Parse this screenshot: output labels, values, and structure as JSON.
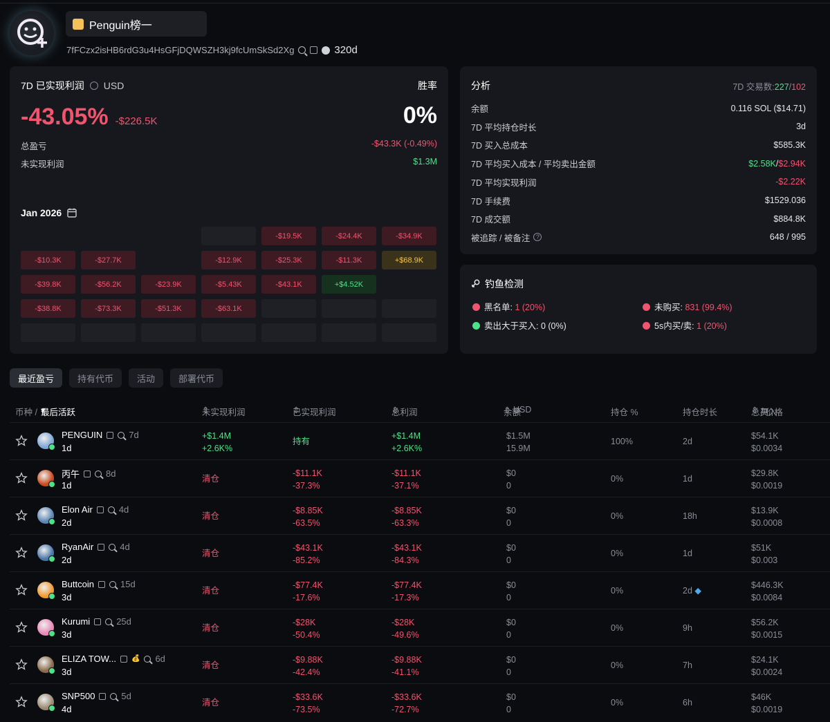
{
  "profile": {
    "name": "Penguin榜一",
    "address": "7fFCzx2isHB6rdG3u4HsGFjDQWSZH3kj9fcUmSkSd2Xg",
    "balance_days": "320d"
  },
  "pnl": {
    "title": "7D 已实现利润",
    "currency": "USD",
    "winrate_label": "胜率",
    "pct": "-43.05%",
    "amount": "-$226.5K",
    "winrate": "0%",
    "total_label": "总盈亏",
    "total_value": "-$43.3K (-0.49%)",
    "unrealized_label": "未实现利润",
    "unrealized_value": "$1.3M",
    "month": "Jan 2026",
    "calendar": [
      [
        "",
        "",
        "",
        "",
        "-$19.5K",
        "-$24.4K",
        "-$34.9K"
      ],
      [
        "-$10.3K",
        "-$27.7K",
        "",
        "-$12.9K",
        "-$25.3K",
        "-$11.3K",
        "+$68.9K"
      ],
      [
        "-$39.8K",
        "-$56.2K",
        "-$23.9K",
        "-$5.43K",
        "-$43.1K",
        "+$4.52K",
        ""
      ],
      [
        "-$38.8K",
        "-$73.3K",
        "-$51.3K",
        "-$63.1K",
        "",
        "",
        ""
      ],
      [
        "",
        "",
        "",
        "",
        "",
        "",
        ""
      ]
    ]
  },
  "analysis": {
    "title": "分析",
    "trades_label": "7D 交易数:",
    "trades_buy": "227",
    "trades_sep": "/",
    "trades_sell": "102",
    "rows": [
      {
        "label": "余额",
        "value": "0.116 SOL ($14.71)"
      },
      {
        "label": "7D 平均持仓时长",
        "value": "3d"
      },
      {
        "label": "7D 买入总成本",
        "value": "$585.3K"
      },
      {
        "label": "7D 平均买入成本 / 平均卖出金额",
        "value": "$2.58K"
      },
      {
        "label": "7D 平均实现利润",
        "value": "-$2.22K"
      },
      {
        "label": "7D 手续费",
        "value": "$1529.036"
      },
      {
        "label": "7D 成交额",
        "value": "$884.8K"
      },
      {
        "label": "被追踪 / 被备注",
        "value": "648 / 995"
      }
    ],
    "avg_sell": "$2.94K",
    "avg_sep": "/"
  },
  "phishing": {
    "title": "钓鱼检测",
    "blacklist_label": "黑名单:",
    "blacklist_value": "1 (20%)",
    "nobuy_label": "未购买:",
    "nobuy_value": "831 (99.4%)",
    "sellgt_label": "卖出大于买入:",
    "sellgt_value": "0 (0%)",
    "fast_label": "5s内买/卖:",
    "fast_value": "1 (20%)"
  },
  "tabs": [
    "最近盈亏",
    "持有代币",
    "活动",
    "部署代币"
  ],
  "columns": {
    "coin": "币种 /",
    "last_active": "最后活跃",
    "unrealized": "未实现利润",
    "realized": "已实现利润",
    "total": "总利润",
    "balance": "余额",
    "usd": "USD",
    "position": "持仓 %",
    "duration": "持仓时长",
    "total_buy": "总买入",
    "price": "/ 价格"
  },
  "rows": [
    {
      "name": "PENGUIN",
      "age": "7d",
      "active": "1d",
      "unreal1": "+$1.4M",
      "unreal2": "+2.6K%",
      "realized1": "持有",
      "realized2": "",
      "total1": "+$1.4M",
      "total2": "+2.6K%",
      "bal1": "$1.5M",
      "bal2": "15.9M",
      "pos": "100%",
      "dur": "2d",
      "buy": "$54.1K",
      "price": "$0.0034",
      "color": "#7fa7d6"
    },
    {
      "name": "丙午",
      "age": "8d",
      "active": "1d",
      "unreal1": "清仓",
      "unreal2": "",
      "realized1": "-$11.1K",
      "realized2": "-37.3%",
      "total1": "-$11.1K",
      "total2": "-37.1%",
      "bal1": "$0",
      "bal2": "0",
      "pos": "0%",
      "dur": "1d",
      "buy": "$29.8K",
      "price": "$0.0019",
      "color": "#c84a1e"
    },
    {
      "name": "Elon Air",
      "age": "4d",
      "active": "2d",
      "unreal1": "清仓",
      "unreal2": "",
      "realized1": "-$8.85K",
      "realized2": "-63.5%",
      "total1": "-$8.85K",
      "total2": "-63.3%",
      "bal1": "$0",
      "bal2": "0",
      "pos": "0%",
      "dur": "18h",
      "buy": "$13.9K",
      "price": "$0.0008",
      "color": "#5a86b5"
    },
    {
      "name": "RyanAir",
      "age": "4d",
      "active": "2d",
      "unreal1": "清仓",
      "unreal2": "",
      "realized1": "-$43.1K",
      "realized2": "-85.2%",
      "total1": "-$43.1K",
      "total2": "-84.3%",
      "bal1": "$0",
      "bal2": "0",
      "pos": "0%",
      "dur": "1d",
      "buy": "$51K",
      "price": "$0.003",
      "color": "#4a76a8"
    },
    {
      "name": "Buttcoin",
      "age": "15d",
      "active": "3d",
      "unreal1": "清仓",
      "unreal2": "",
      "realized1": "-$77.4K",
      "realized2": "-17.6%",
      "total1": "-$77.4K",
      "total2": "-17.3%",
      "bal1": "$0",
      "bal2": "0",
      "pos": "0%",
      "dur": "2d",
      "buy": "$446.3K",
      "price": "$0.0084",
      "color": "#f29a2e"
    },
    {
      "name": "Kurumi",
      "age": "25d",
      "active": "3d",
      "unreal1": "清仓",
      "unreal2": "",
      "realized1": "-$28K",
      "realized2": "-50.4%",
      "total1": "-$28K",
      "total2": "-49.6%",
      "bal1": "$0",
      "bal2": "0",
      "pos": "0%",
      "dur": "9h",
      "buy": "$56.2K",
      "price": "$0.0015",
      "color": "#e889b6"
    },
    {
      "name": "ELIZA TOW...",
      "age": "6d",
      "active": "3d",
      "unreal1": "清仓",
      "unreal2": "",
      "realized1": "-$9.88K",
      "realized2": "-42.4%",
      "total1": "-$9.88K",
      "total2": "-41.1%",
      "bal1": "$0",
      "bal2": "0",
      "pos": "0%",
      "dur": "7h",
      "buy": "$24.1K",
      "price": "$0.0024",
      "color": "#8a6a4a"
    },
    {
      "name": "SNP500",
      "age": "5d",
      "active": "4d",
      "unreal1": "清仓",
      "unreal2": "",
      "realized1": "-$33.6K",
      "realized2": "-73.5%",
      "total1": "-$33.6K",
      "total2": "-72.7%",
      "bal1": "$0",
      "bal2": "0",
      "pos": "0%",
      "dur": "6h",
      "buy": "$46K",
      "price": "$0.0019",
      "color": "#9a8a72"
    }
  ]
}
